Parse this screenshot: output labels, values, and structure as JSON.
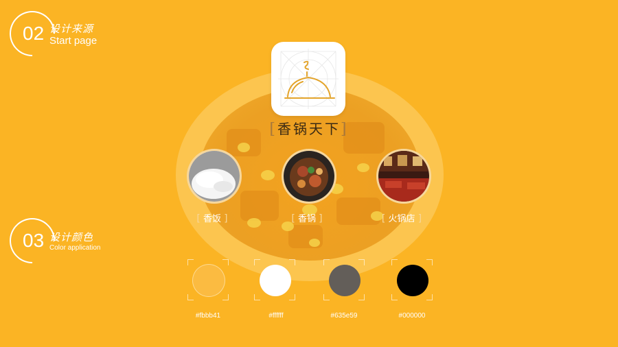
{
  "section_start": {
    "number": "02",
    "title_cn": "设计来源",
    "title_en": "Start page"
  },
  "section_color": {
    "number": "03",
    "title_cn": "设计颜色",
    "title_en": "Color application"
  },
  "app": {
    "name": "香锅天下",
    "bracket_left": "[",
    "bracket_right": "]"
  },
  "foods": [
    {
      "label": "香饭"
    },
    {
      "label": "香锅"
    },
    {
      "label": "火锅店"
    }
  ],
  "swatches": [
    {
      "hex": "#fbbb41",
      "color": "#fbbb41"
    },
    {
      "hex": "#ffffff",
      "color": "#ffffff"
    },
    {
      "hex": "#635e59",
      "color": "#635e59"
    },
    {
      "hex": "#000000",
      "color": "#000000"
    }
  ],
  "colors": {
    "background": "#fbb424",
    "icon_stroke": "#e3a42b"
  }
}
